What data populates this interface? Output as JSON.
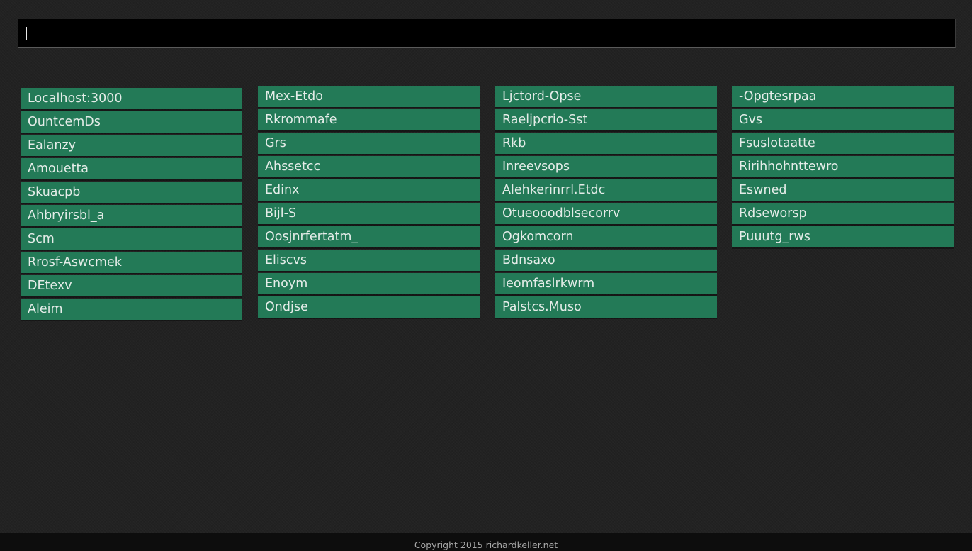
{
  "search": {
    "value": "",
    "placeholder": ""
  },
  "columns": [
    [
      "Localhost:3000",
      "OuntcemDs",
      "Ealanzy",
      "Amouetta",
      "Skuacpb",
      "Ahbryirsbl_a",
      "Scm",
      "Rrosf-Aswcmek",
      "DEtexv",
      "Aleim"
    ],
    [
      "Mex-Etdo",
      "Rkrommafe",
      "Grs",
      "Ahssetcc",
      "Edinx",
      "Bijl-S",
      "Oosjnrfertatm_",
      "Eliscvs",
      "Enoym",
      "Ondjse"
    ],
    [
      "Ljctord-Opse",
      "Raeljpcrio-Sst",
      "Rkb",
      "Inreevsops",
      "Alehkerinrrl.Etdc",
      "Otueooodblsecorrv",
      "Ogkomcorn",
      "Bdnsaxo",
      "Ieomfaslrkwrm",
      "Palstcs.Muso"
    ],
    [
      "-Opgtesrpaa",
      "Gvs",
      "Fsuslotaatte",
      "Ririhhohnttewro",
      "Eswned",
      "Rdseworsp",
      "Puuutg_rws"
    ]
  ],
  "footer": {
    "copyright": "Copyright 2015 richardkeller.net"
  },
  "colors": {
    "background": "#222222",
    "tile": "#237a57",
    "tile_text": "#e4ece8",
    "search_background": "#000000",
    "footer_background": "#0d0d0d"
  }
}
